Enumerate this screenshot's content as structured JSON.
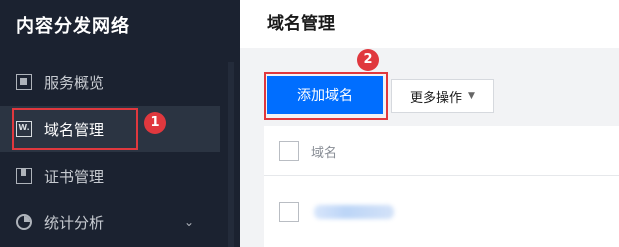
{
  "sidebar": {
    "brand": "内容分发网络",
    "items": [
      {
        "label": "服务概览",
        "icon": "overview-icon"
      },
      {
        "label": "域名管理",
        "icon": "domain-icon",
        "icon_text": "W."
      },
      {
        "label": "证书管理",
        "icon": "certificate-icon"
      },
      {
        "label": "统计分析",
        "icon": "stats-pie-icon"
      }
    ]
  },
  "header": {
    "title": "域名管理"
  },
  "toolbar": {
    "add_label": "添加域名",
    "more_label": "更多操作"
  },
  "table": {
    "columns": [
      "域名"
    ]
  },
  "annotations": {
    "step1": "1",
    "step2": "2"
  },
  "colors": {
    "accent": "#006eff",
    "highlight": "#e0383e",
    "sidebar": "#1b2230"
  }
}
